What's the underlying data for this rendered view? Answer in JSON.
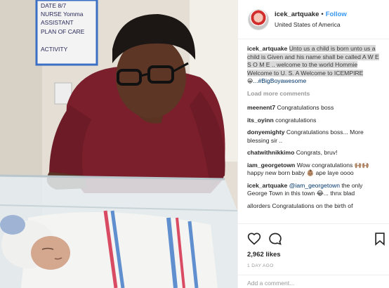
{
  "photo": {
    "whiteboard_lines": [
      "DATE 8/7",
      "NURSE Yomma",
      "ASSISTANT",
      "PLAN OF CARE",
      "ACTIVITY"
    ]
  },
  "post": {
    "username": "icek_artquake",
    "separator": "•",
    "follow_label": "Follow",
    "location": "United States of America",
    "caption_user": "icek_artquake",
    "caption_text": "Unto us a child is born unto us a child is Given and his name shall be called A W E S O M E .. welcome to the world Hommie Welcome to U. S. A Welcome to ICEMPIRE",
    "caption_emoji": "😀",
    "caption_hashtag": "...#BigBoyawesome",
    "load_more_label": "Load more comments",
    "comments": [
      {
        "user": "meenent7",
        "text": "Congratulations boss"
      },
      {
        "user": "its_oyinn",
        "text": "congratulations"
      },
      {
        "user": "donyemighty",
        "text": "Congratulations boss... More blessing sir .."
      },
      {
        "user": "chatwithnikkimo",
        "text": "Congrats, bruv!"
      },
      {
        "user": "iam_georgetown",
        "text": "Wow congratulations 🙌🏽🙌🏽 happy new born baby 👶🏽 ape laye oooo"
      },
      {
        "user": "icek_artquake",
        "mention": "@iam_georgetown",
        "text": "the only George Town in this town 😂... thnx blad"
      }
    ],
    "partial_comment": "allorders Congratulations on the birth of",
    "likes": "2,962 likes",
    "timestamp": "1 DAY AGO",
    "add_comment_placeholder": "Add a comment..."
  },
  "colors": {
    "accent": "#3897f0",
    "caption_highlight": "#d9d9d9",
    "shirt": "#7a1f2b",
    "border": "#efefef"
  },
  "icons": [
    "heart-icon",
    "comment-icon",
    "bookmark-icon"
  ]
}
